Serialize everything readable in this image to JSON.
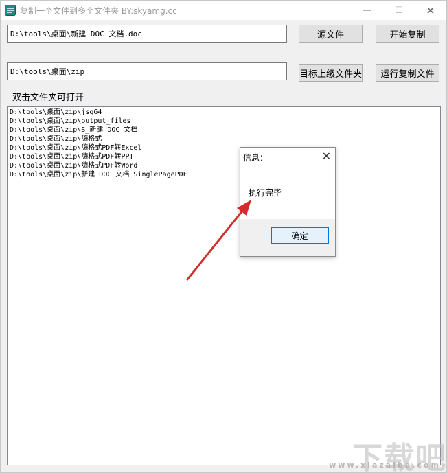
{
  "window": {
    "title": "复制一个文件到多个文件夹  BY:skyamg.cc",
    "controls": {
      "minimize": "—",
      "maximize": "☐",
      "close": "✕"
    }
  },
  "source": {
    "path_value": "D:\\tools\\桌面\\新建 DOC 文档.doc",
    "button_label": "源文件"
  },
  "start_copy": {
    "button_label": "开始复制"
  },
  "target": {
    "path_value": "D:\\tools\\桌面\\zip",
    "button_label": "目标上级文件夹"
  },
  "run_copy": {
    "button_label": "运行复制文件"
  },
  "hint": "双击文件夹可打开",
  "folders": [
    "D:\\tools\\桌面\\zip\\jsq64",
    "D:\\tools\\桌面\\zip\\output_files",
    "D:\\tools\\桌面\\zip\\S_新建 DOC 文档",
    "D:\\tools\\桌面\\zip\\嗨格式",
    "D:\\tools\\桌面\\zip\\嗨格式PDF转Excel",
    "D:\\tools\\桌面\\zip\\嗨格式PDF转PPT",
    "D:\\tools\\桌面\\zip\\嗨格式PDF转Word",
    "D:\\tools\\桌面\\zip\\新建 DOC 文档_SinglePagePDF"
  ],
  "dialog": {
    "title": "信息：",
    "message": "执行完毕",
    "ok_label": "确定",
    "close": "✕"
  },
  "watermark": {
    "main": "下载吧",
    "sub": "www.xiazaiba.com"
  },
  "colors": {
    "accent": "#0078d7",
    "arrow": "#d62b2b"
  }
}
